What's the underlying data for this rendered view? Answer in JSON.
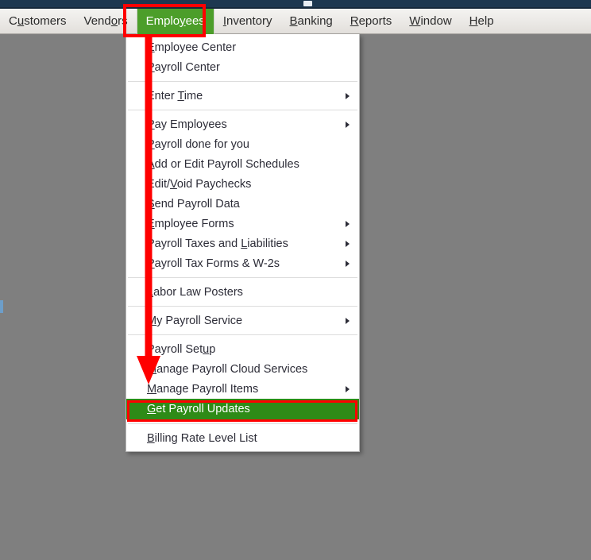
{
  "window": {
    "titlebar_color": "#1d3850",
    "background_color": "#7f7f7f"
  },
  "menubar": {
    "accent_color": "#4c9e2a",
    "items": [
      {
        "label": "Customers",
        "accel": "u",
        "active": false
      },
      {
        "label": "Vendors",
        "accel": "o",
        "active": false
      },
      {
        "label": "Employees",
        "accel": "y",
        "active": true
      },
      {
        "label": "Inventory",
        "accel": "I",
        "active": false
      },
      {
        "label": "Banking",
        "accel": "B",
        "active": false
      },
      {
        "label": "Reports",
        "accel": "R",
        "active": false
      },
      {
        "label": "Window",
        "accel": "W",
        "active": false
      },
      {
        "label": "Help",
        "accel": "H",
        "active": false
      }
    ]
  },
  "dropdown": {
    "owner": "Employees",
    "highlight_bg": "#2e8b17",
    "annotation_color": "#ff0000",
    "items": [
      {
        "type": "item",
        "label": "Employee Center",
        "accel": "E",
        "submenu": false,
        "highlight": false
      },
      {
        "type": "item",
        "label": "Payroll Center",
        "accel": "P",
        "submenu": false,
        "highlight": false
      },
      {
        "type": "separator"
      },
      {
        "type": "item",
        "label": "Enter Time",
        "accel": "T",
        "submenu": true,
        "highlight": false
      },
      {
        "type": "separator"
      },
      {
        "type": "item",
        "label": "Pay Employees",
        "accel": "P",
        "submenu": true,
        "highlight": false
      },
      {
        "type": "item",
        "label": "Payroll done for you",
        "accel": "P",
        "submenu": false,
        "highlight": false
      },
      {
        "type": "item",
        "label": "Add or Edit Payroll Schedules",
        "accel": "A",
        "submenu": false,
        "highlight": false
      },
      {
        "type": "item",
        "label": "Edit/Void Paychecks",
        "accel": "V",
        "submenu": false,
        "highlight": false
      },
      {
        "type": "item",
        "label": "Send Payroll Data",
        "accel": "S",
        "submenu": false,
        "highlight": false
      },
      {
        "type": "item",
        "label": "Employee Forms",
        "accel": "E",
        "submenu": true,
        "highlight": false
      },
      {
        "type": "item",
        "label": "Payroll Taxes and Liabilities",
        "accel": "L",
        "submenu": true,
        "highlight": false
      },
      {
        "type": "item",
        "label": "Payroll Tax Forms & W-2s",
        "accel": "P",
        "submenu": true,
        "highlight": false
      },
      {
        "type": "separator"
      },
      {
        "type": "item",
        "label": "Labor Law Posters",
        "accel": "L",
        "submenu": false,
        "highlight": false
      },
      {
        "type": "separator"
      },
      {
        "type": "item",
        "label": "My Payroll Service",
        "accel": "M",
        "submenu": true,
        "highlight": false
      },
      {
        "type": "separator"
      },
      {
        "type": "item",
        "label": "Payroll Setup",
        "accel": "u",
        "submenu": false,
        "highlight": false
      },
      {
        "type": "item",
        "label": "Manage Payroll Cloud Services",
        "accel": "M",
        "submenu": false,
        "highlight": false
      },
      {
        "type": "item",
        "label": "Manage Payroll Items",
        "accel": "M",
        "submenu": true,
        "highlight": false
      },
      {
        "type": "item",
        "label": "Get Payroll Updates",
        "accel": "G",
        "submenu": false,
        "highlight": true
      },
      {
        "type": "separator"
      },
      {
        "type": "item",
        "label": "Billing Rate Level List",
        "accel": "B",
        "submenu": false,
        "highlight": false
      }
    ]
  }
}
